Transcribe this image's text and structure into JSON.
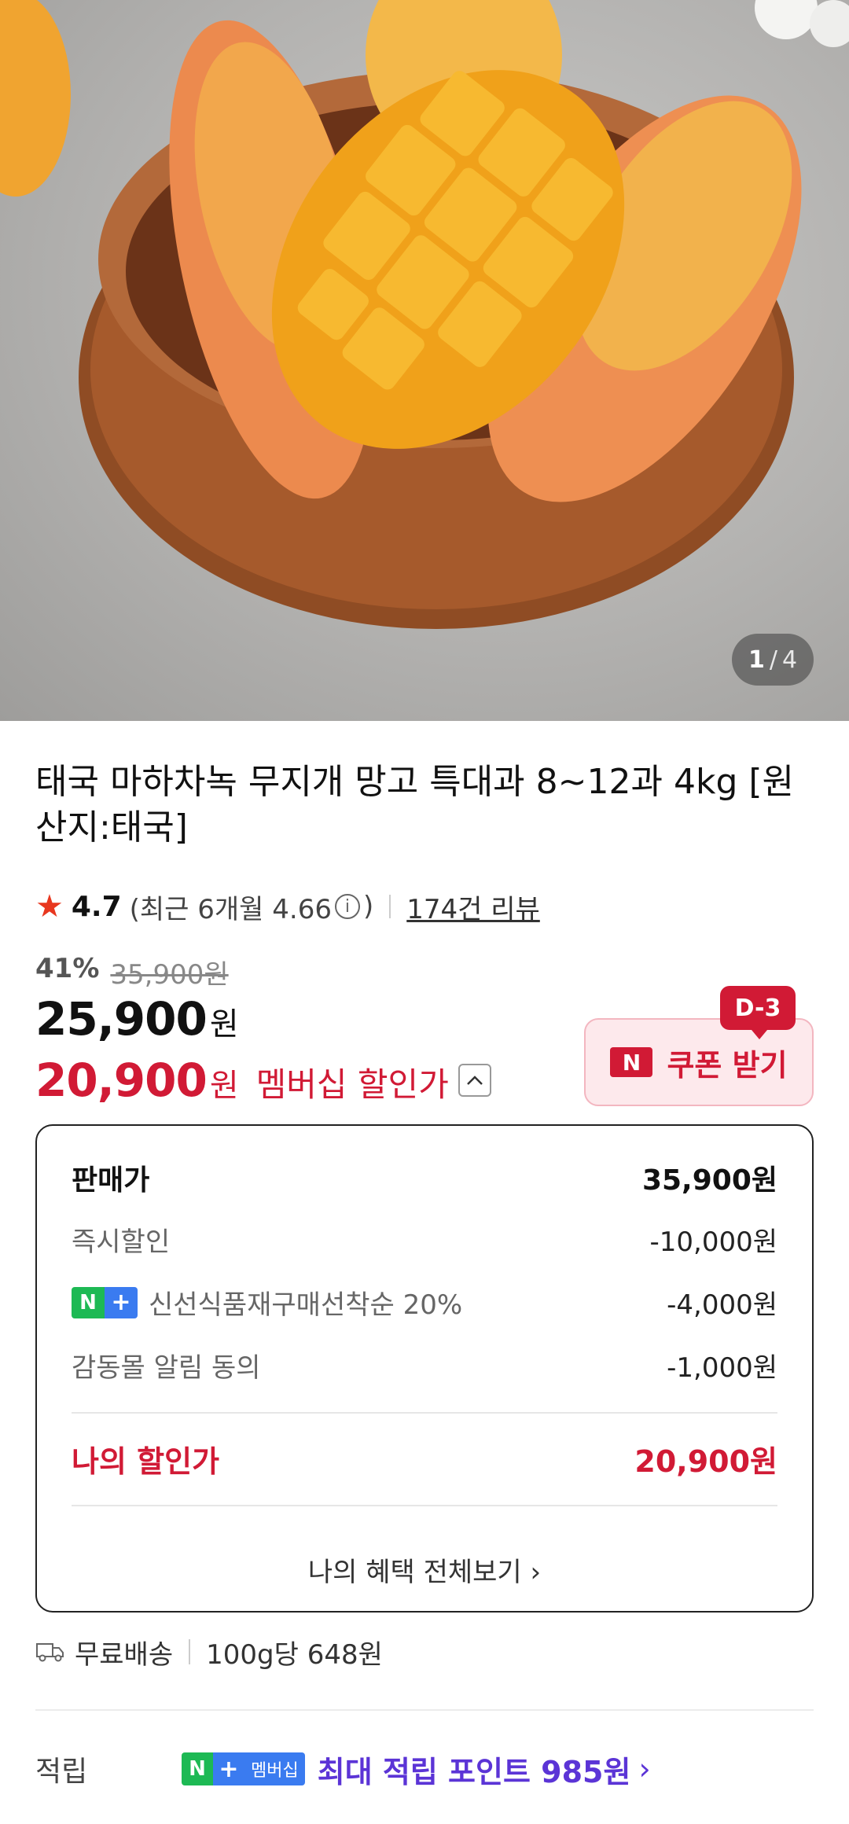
{
  "image_pager": {
    "current": "1",
    "separator": "/",
    "total": "4"
  },
  "product": {
    "title": "태국 마하차녹 무지개 망고 특대과 8~12과 4kg [원산지:태국]"
  },
  "rating": {
    "star_icon": "star-icon",
    "score": "4.7",
    "recent_text": "(최근 6개월 4.66",
    "recent_close": ")",
    "info_icon": "info-icon",
    "reviews_link": "174건 리뷰"
  },
  "price": {
    "discount_rate": "41%",
    "original": "35,900원",
    "sale_price": "25,900",
    "sale_unit": "원",
    "member_price": "20,900",
    "member_unit": "원",
    "member_label": "멤버십 할인가"
  },
  "coupon": {
    "dday": "D-3",
    "badge": "N",
    "label": "쿠폰 받기"
  },
  "breakdown": {
    "header_label": "판매가",
    "header_amount": "35,900원",
    "rows": [
      {
        "label": "즉시할인",
        "amount": "-10,000원"
      },
      {
        "label": "신선식품재구매선착순 20%",
        "amount": "-4,000원"
      },
      {
        "label": "감동몰 알림 동의",
        "amount": "-1,000원"
      }
    ],
    "my_price_label": "나의 할인가",
    "my_price_amount": "20,900원",
    "benefits_link": "나의 혜택 전체보기"
  },
  "nplus_badge": {
    "n": "N",
    "plus": "+"
  },
  "shipping": {
    "free_shipping": "무료배송",
    "unit_price": "100g당 648원"
  },
  "points": {
    "label": "적립",
    "badge_n": "N",
    "badge_plus": "+",
    "badge_member": "멤버십",
    "text": "최대 적립 포인트 985원"
  },
  "colors": {
    "accent_red": "#d11a35",
    "points_purple": "#5b34d6",
    "nplus_green": "#1db954",
    "nplus_blue": "#3a7bf0"
  }
}
